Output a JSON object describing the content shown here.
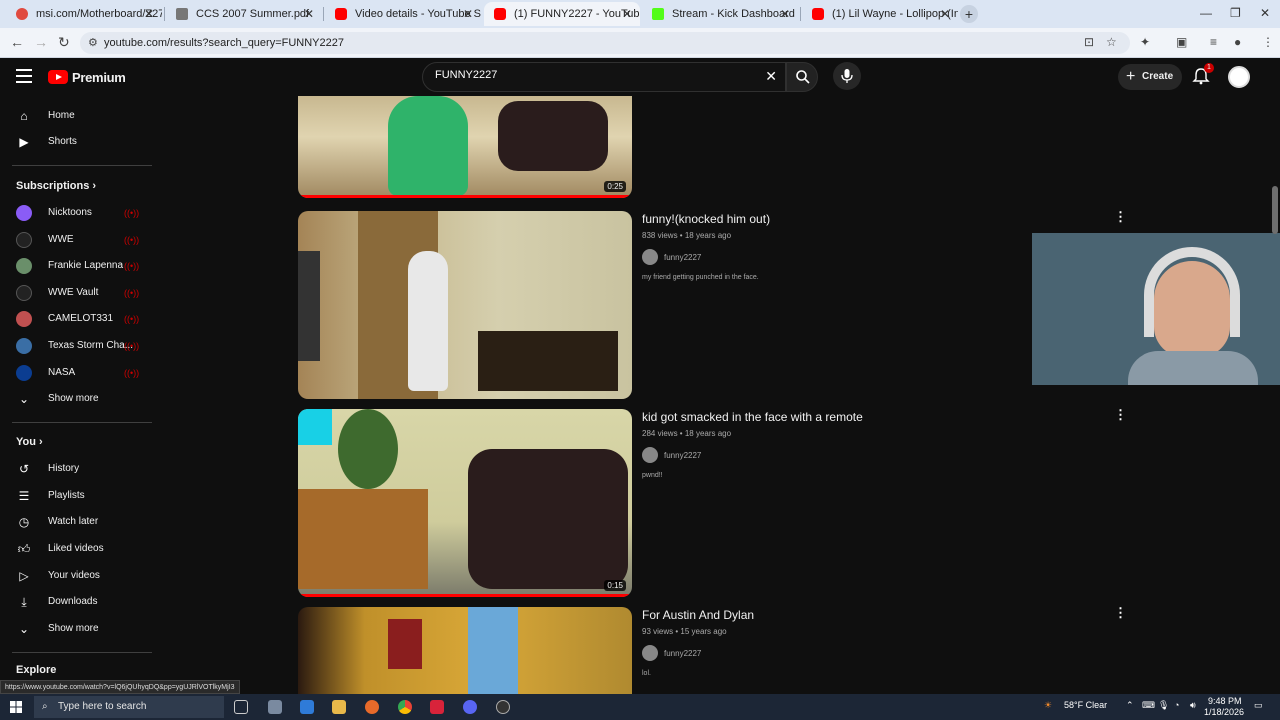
{
  "browser": {
    "tabs": [
      {
        "label": "msi.com/Motherboard/Z270-A",
        "color": "#e04a3f"
      },
      {
        "label": "CCS 2007 Summer.pdf",
        "color": "#555555"
      },
      {
        "label": "Video details - YouTube Studio",
        "color": "#ff0000"
      },
      {
        "label": "(1) FUNNY2227 - YouTube",
        "color": "#ff0000"
      },
      {
        "label": "Stream - Kick Dashboard",
        "color": "#53fc18"
      },
      {
        "label": "(1) Lil Wayne - Lollipop (Instru",
        "color": "#ff0000"
      }
    ],
    "url": "youtube.com/results?search_query=FUNNY2227"
  },
  "header": {
    "logo_text": "Premium",
    "search_value": "FUNNY2227",
    "create_label": "Create",
    "notification_count": "1"
  },
  "sidebar": {
    "home": "Home",
    "shorts": "Shorts",
    "subscriptions_title": "Subscriptions",
    "subscriptions": [
      {
        "label": "Nicktoons",
        "color": "#8a5cf6"
      },
      {
        "label": "WWE",
        "color": "#222222"
      },
      {
        "label": "Frankie Lapenna",
        "color": "#6a8f6a"
      },
      {
        "label": "WWE Vault",
        "color": "#222222"
      },
      {
        "label": "CAMELOT331",
        "color": "#c05050"
      },
      {
        "label": "Texas Storm Cha...",
        "color": "#3a6ea5"
      },
      {
        "label": "NASA",
        "color": "#0b3d91"
      }
    ],
    "show_more_1": "Show more",
    "you_title": "You",
    "you_items": [
      {
        "label": "History",
        "icon": "history-icon"
      },
      {
        "label": "Playlists",
        "icon": "playlists-icon"
      },
      {
        "label": "Watch later",
        "icon": "clock-icon"
      },
      {
        "label": "Liked videos",
        "icon": "thumbs-up-icon"
      },
      {
        "label": "Your videos",
        "icon": "play-icon"
      },
      {
        "label": "Downloads",
        "icon": "download-icon"
      }
    ],
    "show_more_2": "Show more",
    "explore_title": "Explore"
  },
  "results": [
    {
      "title": "",
      "meta": "",
      "channel": "",
      "desc": "",
      "duration": "0:25",
      "progress": 1.0
    },
    {
      "title": "funny!(knocked him out)",
      "meta": "838 views • 18 years ago",
      "channel": "funny2227",
      "desc": "my friend getting punched in the face.",
      "duration": "",
      "progress": 0
    },
    {
      "title": "kid got smacked in the face with a remote",
      "meta": "284 views • 18 years ago",
      "channel": "funny2227",
      "desc": "pwnd!!",
      "duration": "0:15",
      "progress": 1.0
    },
    {
      "title": "For Austin And Dylan",
      "meta": "93 views • 15 years ago",
      "channel": "funny2227",
      "desc": "lol.",
      "duration": "",
      "progress": 0
    }
  ],
  "status_url": "https://www.youtube.com/watch?v=lQ6jQUhyqDQ&pp=ygUJRlVOTlkyMjI3",
  "taskbar": {
    "search_placeholder": "Type here to search",
    "weather": "58°F  Clear",
    "time": "9:48 PM",
    "date": "1/18/2026"
  }
}
